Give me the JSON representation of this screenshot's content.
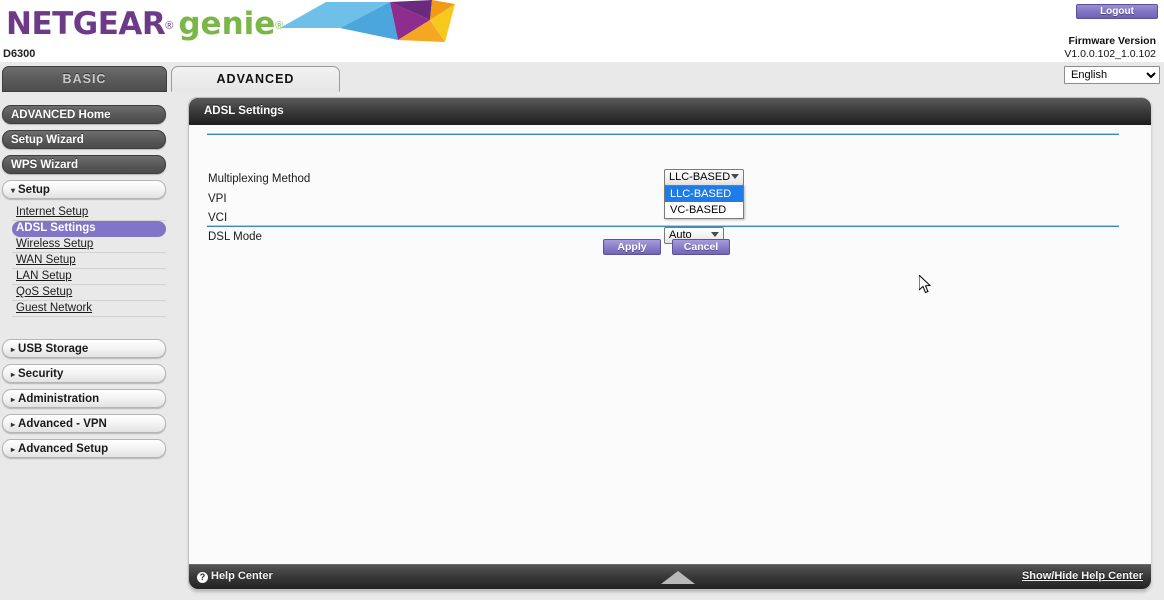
{
  "header": {
    "brand_netgear": "NETGEAR",
    "brand_genie": "genie",
    "registered_mark": "®",
    "model": "D6300",
    "logout_label": "Logout",
    "firmware_label": "Firmware Version",
    "firmware_value": "V1.0.0.102_1.0.102",
    "language_selected": "English",
    "language_options": [
      "English"
    ]
  },
  "tabs": [
    {
      "label": "BASIC",
      "active": false
    },
    {
      "label": "ADVANCED",
      "active": true
    }
  ],
  "sidebar": {
    "buttons": [
      {
        "label": "ADVANCED Home",
        "style": "dark",
        "caret": ""
      },
      {
        "label": "Setup Wizard",
        "style": "dark",
        "caret": ""
      },
      {
        "label": "WPS Wizard",
        "style": "dark",
        "caret": ""
      },
      {
        "label": "Setup",
        "style": "light",
        "caret": "▾"
      }
    ],
    "submenu": [
      {
        "label": "Internet Setup",
        "active": false
      },
      {
        "label": "ADSL Settings",
        "active": true
      },
      {
        "label": "Wireless Setup",
        "active": false
      },
      {
        "label": "WAN Setup",
        "active": false
      },
      {
        "label": "LAN Setup",
        "active": false
      },
      {
        "label": "QoS Setup",
        "active": false
      },
      {
        "label": "Guest Network",
        "active": false
      }
    ],
    "sections": [
      {
        "label": "USB Storage",
        "caret": "▸"
      },
      {
        "label": "Security",
        "caret": "▸"
      },
      {
        "label": "Administration",
        "caret": "▸"
      },
      {
        "label": "Advanced - VPN",
        "caret": "▸"
      },
      {
        "label": "Advanced Setup",
        "caret": "▸"
      }
    ]
  },
  "panel": {
    "title": "ADSL Settings",
    "fields": {
      "multiplexing_label": "Multiplexing Method",
      "multiplexing_value": "LLC-BASED",
      "multiplexing_options": [
        "LLC-BASED",
        "VC-BASED"
      ],
      "multiplexing_open": true,
      "vpi_label": "VPI",
      "vpi_value": "",
      "vci_label": "VCI",
      "vci_value": "",
      "dsl_mode_label": "DSL Mode",
      "dsl_mode_value": "Auto"
    },
    "apply_label": "Apply",
    "cancel_label": "Cancel"
  },
  "footer": {
    "help_center_label": "Help Center",
    "help_icon": "?",
    "show_hide_label": "Show/Hide Help Center"
  },
  "colors": {
    "brand_purple": "#6d3a87",
    "brand_green": "#7ab648",
    "accent_purple": "#8175c8",
    "separator_blue": "#3f8ab5",
    "dropdown_highlight": "#1d7ce8"
  }
}
